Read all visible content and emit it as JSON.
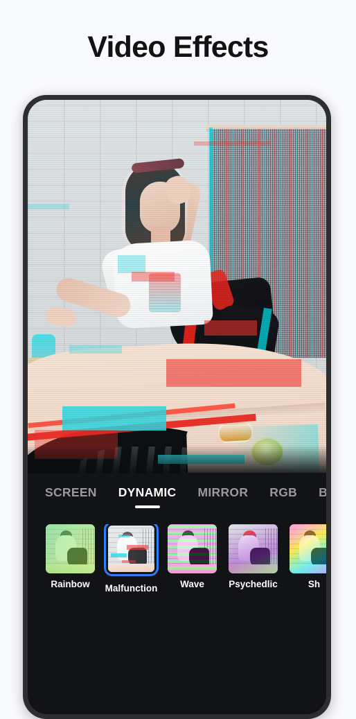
{
  "header": {
    "title": "Video Effects"
  },
  "colors": {
    "page_background": "#f9fafd",
    "title_text": "#121212",
    "panel_background": "#121316",
    "phone_frame": "#2e2e30",
    "accent_selected": "#2f7df4",
    "tab_active": "#ffffff",
    "tab_inactive": "#9a9a9c",
    "glitch_red": "#f0322d",
    "glitch_cyan": "#2dd7e1"
  },
  "preview": {
    "description": "glitch-effect video preview of a woman sitting on a car hood in front of a brick wall"
  },
  "tabs": [
    {
      "label": "SCREEN",
      "active": false
    },
    {
      "label": "DYNAMIC",
      "active": true
    },
    {
      "label": "MIRROR",
      "active": false
    },
    {
      "label": "RGB",
      "active": false
    },
    {
      "label": "BENDING",
      "active": false
    }
  ],
  "effects": [
    {
      "label": "Rainbow",
      "selected": false
    },
    {
      "label": "Malfunction",
      "selected": true
    },
    {
      "label": "Wave",
      "selected": false
    },
    {
      "label": "Psychedlic",
      "selected": false
    },
    {
      "label": "Sh",
      "selected": false
    }
  ]
}
